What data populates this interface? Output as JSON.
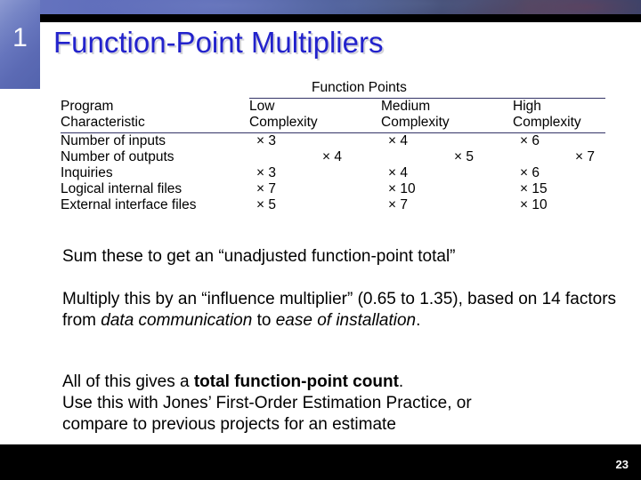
{
  "slide": {
    "number": "1",
    "title": "Function-Point Multipliers",
    "page_number": "23",
    "accent_color": "#2222cc",
    "slab_color": "#6675bd",
    "bar_color": "#000000"
  },
  "table": {
    "group_header": "Function Points",
    "headers": {
      "label_line1": "Program",
      "label_line2": "Characteristic",
      "low_line1": "Low",
      "low_line2": "Complexity",
      "medium_line1": "Medium",
      "medium_line2": "Complexity",
      "high_line1": "High",
      "high_line2": "Complexity"
    },
    "rows": [
      {
        "label": "Number of inputs",
        "low": "× 3",
        "medium": "× 4",
        "high": "× 6"
      },
      {
        "label": "Number of outputs",
        "low": "× 4",
        "medium": "× 5",
        "high": "× 7"
      },
      {
        "label": "Inquiries",
        "low": "× 3",
        "medium": "× 4",
        "high": "× 6"
      },
      {
        "label": "Logical internal files",
        "low": "× 7",
        "medium": "× 10",
        "high": "× 15"
      },
      {
        "label": "External interface files",
        "low": "× 5",
        "medium": "× 7",
        "high": "× 10"
      }
    ]
  },
  "body": {
    "para1": "Sum these to get an “unadjusted function-point total”",
    "para2_part1": "Multiply this by an “influence multiplier” (0.65 to 1.35), based on 14 factors from ",
    "para2_em1": "data communication",
    "para2_part2": " to ",
    "para2_em2": "ease of installation",
    "para2_part3": ".",
    "para3_part1": "All of this gives a ",
    "para3_strong": "total function-point count",
    "para3_part2": ".",
    "para3_line2": "Use this with Jones’ First-Order Estimation Practice, or",
    "para3_line3": "compare to previous projects for an estimate"
  }
}
